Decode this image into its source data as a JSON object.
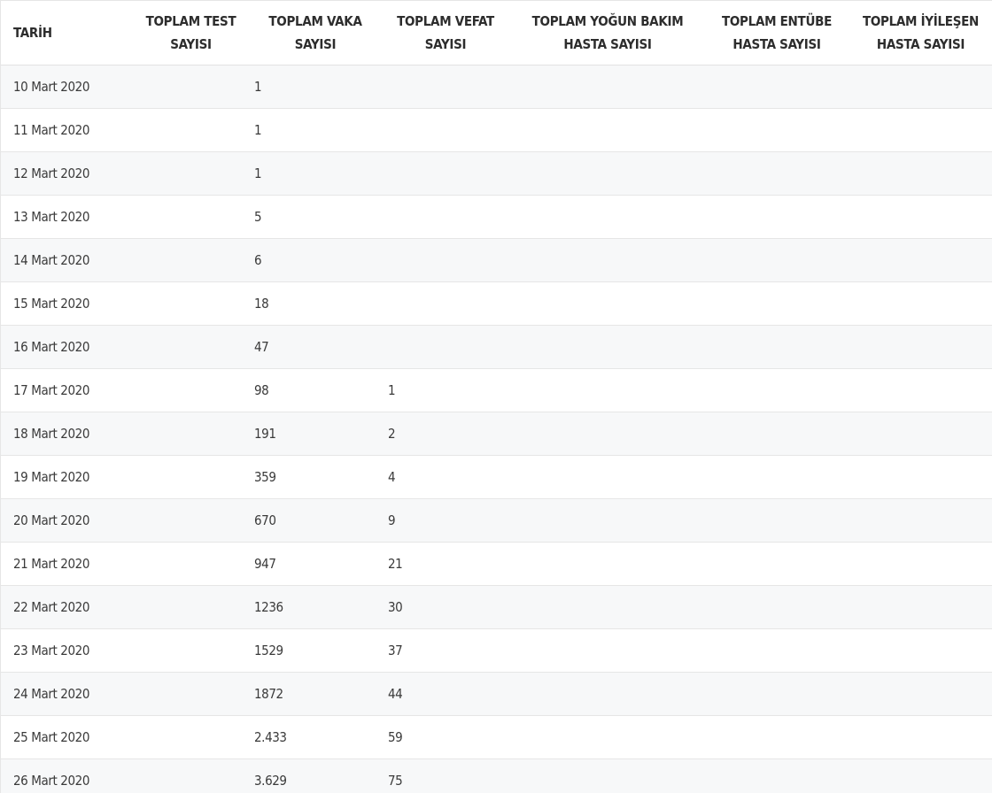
{
  "table": {
    "headers": [
      "TARİH",
      "TOPLAM TEST SAYISI",
      "TOPLAM VAKA SAYISI",
      "TOPLAM VEFAT SAYISI",
      "TOPLAM YOĞUN BAKIM HASTA SAYISI",
      "TOPLAM ENTÜBE HASTA SAYISI",
      "TOPLAM İYİLEŞEN HASTA SAYISI"
    ],
    "rows": [
      [
        "10 Mart 2020",
        "",
        "1",
        "",
        "",
        "",
        ""
      ],
      [
        "11 Mart 2020",
        "",
        "1",
        "",
        "",
        "",
        ""
      ],
      [
        "12 Mart 2020",
        "",
        "1",
        "",
        "",
        "",
        ""
      ],
      [
        "13 Mart 2020",
        "",
        "5",
        "",
        "",
        "",
        ""
      ],
      [
        "14 Mart 2020",
        "",
        "6",
        "",
        "",
        "",
        ""
      ],
      [
        "15 Mart 2020",
        "",
        "18",
        "",
        "",
        "",
        ""
      ],
      [
        "16 Mart 2020",
        "",
        "47",
        "",
        "",
        "",
        ""
      ],
      [
        "17 Mart 2020",
        "",
        "98",
        "1",
        "",
        "",
        ""
      ],
      [
        "18 Mart 2020",
        "",
        "191",
        "2",
        "",
        "",
        ""
      ],
      [
        "19 Mart 2020",
        "",
        "359",
        "4",
        "",
        "",
        ""
      ],
      [
        "20 Mart 2020",
        "",
        "670",
        "9",
        "",
        "",
        ""
      ],
      [
        "21 Mart 2020",
        "",
        "947",
        "21",
        "",
        "",
        ""
      ],
      [
        "22 Mart 2020",
        "",
        "1236",
        "30",
        "",
        "",
        ""
      ],
      [
        "23 Mart 2020",
        "",
        "1529",
        "37",
        "",
        "",
        ""
      ],
      [
        "24 Mart 2020",
        "",
        "1872",
        "44",
        "",
        "",
        ""
      ],
      [
        "25 Mart 2020",
        "",
        "2.433",
        "59",
        "",
        "",
        ""
      ],
      [
        "26 Mart 2020",
        "",
        "3.629",
        "75",
        "",
        "",
        ""
      ]
    ]
  }
}
